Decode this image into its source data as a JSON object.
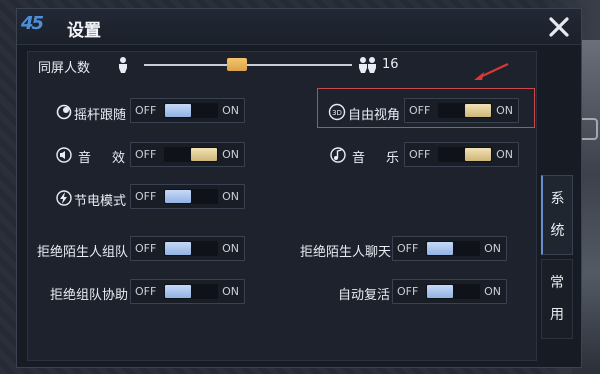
{
  "window": {
    "title": "设置",
    "logo_text": "45"
  },
  "slider": {
    "label": "同屏人数",
    "value": "16",
    "fraction": 0.44
  },
  "toggles": [
    {
      "id": "joystick",
      "label": "摇杆跟随",
      "off": "OFF",
      "on": "ON",
      "state": "off",
      "icon": "joystick-icon"
    },
    {
      "id": "freeview",
      "label": "自由视角",
      "off": "OFF",
      "on": "ON",
      "state": "on",
      "icon": "3d-view-icon"
    },
    {
      "id": "sfx",
      "label": "音　效",
      "off": "OFF",
      "on": "ON",
      "state": "on",
      "icon": "speaker-icon"
    },
    {
      "id": "music",
      "label": "音　乐",
      "off": "OFF",
      "on": "ON",
      "state": "on",
      "icon": "music-note-icon"
    },
    {
      "id": "power",
      "label": "节电模式",
      "off": "OFF",
      "on": "ON",
      "state": "off",
      "icon": "lightning-icon"
    },
    {
      "id": "reject_team",
      "label": "拒绝陌生人组队",
      "off": "OFF",
      "on": "ON",
      "state": "off"
    },
    {
      "id": "reject_chat",
      "label": "拒绝陌生人聊天",
      "off": "OFF",
      "on": "ON",
      "state": "off"
    },
    {
      "id": "reject_assist",
      "label": "拒绝组队协助",
      "off": "OFF",
      "on": "ON",
      "state": "off"
    },
    {
      "id": "auto_revive",
      "label": "自动复活",
      "off": "OFF",
      "on": "ON",
      "state": "off"
    }
  ],
  "tabs": [
    {
      "label_1": "系",
      "label_2": "统",
      "active": true
    },
    {
      "label_1": "常",
      "label_2": "用",
      "active": false
    }
  ],
  "colors": {
    "accent_gold": "#d9a24a",
    "toggle_blue": "#92b3e4",
    "highlight_red": "#c9484a",
    "arrow_red": "#d9363a"
  }
}
